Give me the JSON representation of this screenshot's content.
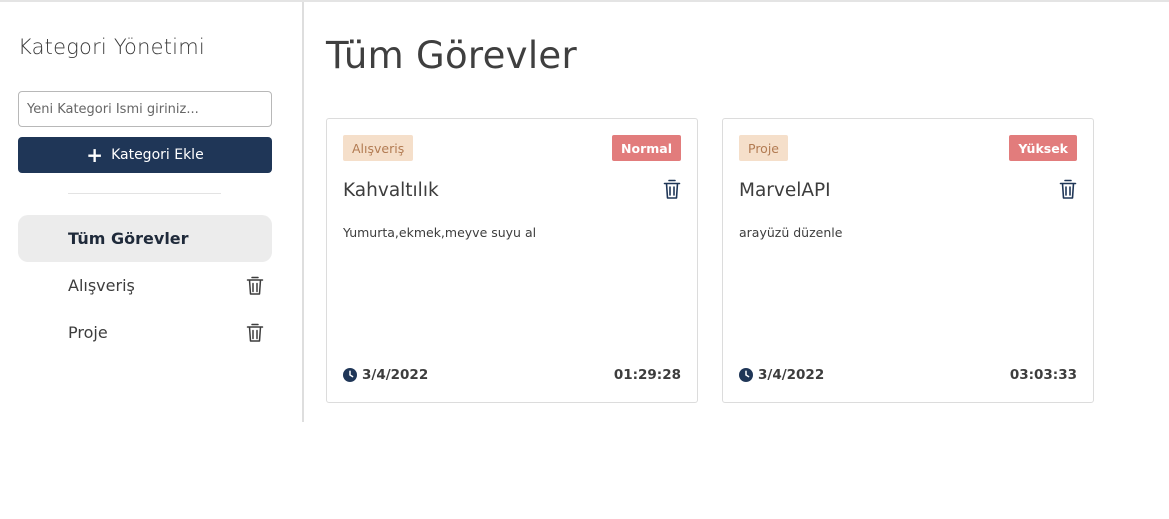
{
  "sidebar": {
    "title": "Kategori Yönetimi",
    "input_placeholder": "Yeni Kategori İsmi giriniz...",
    "add_button_label": "Kategori Ekle",
    "items": [
      {
        "label": "Tüm Görevler",
        "active": true
      },
      {
        "label": "Alışveriş",
        "active": false
      },
      {
        "label": "Proje",
        "active": false
      }
    ]
  },
  "main": {
    "title": "Tüm Görevler",
    "cards": [
      {
        "category": "Alışveriş",
        "priority": "Normal",
        "title": "Kahvaltılık",
        "description": "Yumurta,ekmek,meyve suyu al",
        "date": "3/4/2022",
        "time": "01:29:28"
      },
      {
        "category": "Proje",
        "priority": "Yüksek",
        "title": "MarvelAPI",
        "description": "arayüzü düzenle",
        "date": "3/4/2022",
        "time": "03:03:33"
      }
    ]
  },
  "colors": {
    "primary": "#1f3657",
    "category_badge_bg": "#f5dfca",
    "category_badge_text": "#b27b52",
    "priority_badge_bg": "#e27c7c",
    "active_nav_bg": "#ececec"
  },
  "icons": {
    "add": "plus-icon",
    "delete": "trash-icon",
    "date": "clock-icon"
  }
}
